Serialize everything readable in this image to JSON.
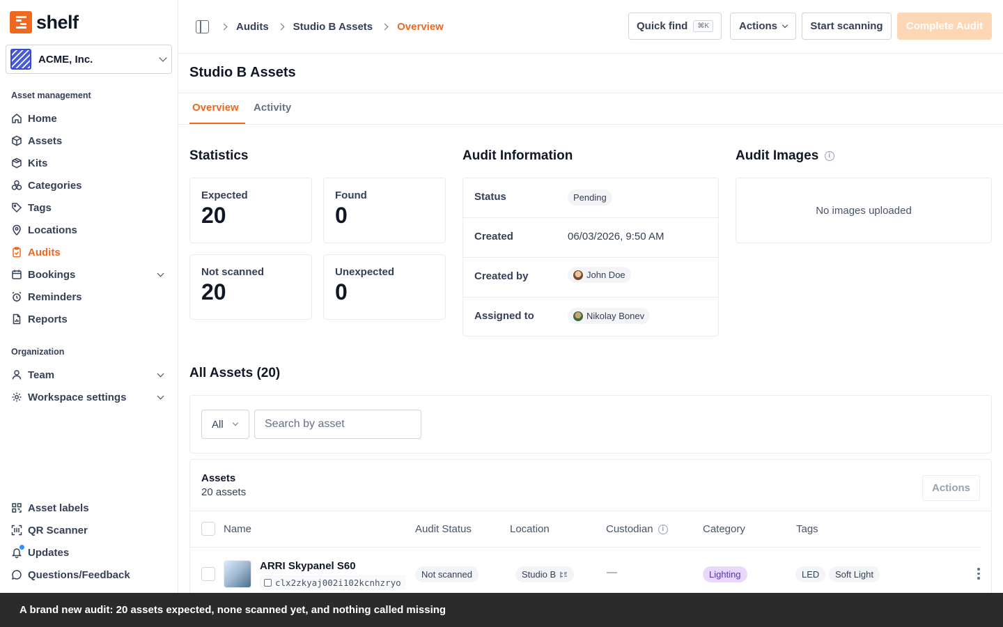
{
  "brand": {
    "name": "shelf"
  },
  "org": {
    "name": "ACME, Inc."
  },
  "sidebar": {
    "section_asset_mgmt": "Asset management",
    "section_org": "Organization",
    "items": [
      {
        "label": "Home",
        "icon": "home-icon"
      },
      {
        "label": "Assets",
        "icon": "box-icon"
      },
      {
        "label": "Kits",
        "icon": "package-icon"
      },
      {
        "label": "Categories",
        "icon": "shapes-icon"
      },
      {
        "label": "Tags",
        "icon": "tag-icon"
      },
      {
        "label": "Locations",
        "icon": "map-pin-icon"
      },
      {
        "label": "Audits",
        "icon": "clipboard-icon",
        "active": true
      },
      {
        "label": "Bookings",
        "icon": "calendar-icon"
      },
      {
        "label": "Reminders",
        "icon": "alarm-icon"
      },
      {
        "label": "Reports",
        "icon": "file-chart-icon"
      }
    ],
    "org_items": [
      {
        "label": "Team",
        "icon": "user-icon"
      },
      {
        "label": "Workspace settings",
        "icon": "gear-icon"
      }
    ],
    "bottom_items": [
      {
        "label": "Asset labels",
        "icon": "qr-code-icon"
      },
      {
        "label": "QR Scanner",
        "icon": "scan-icon"
      },
      {
        "label": "Updates",
        "icon": "bell-icon"
      },
      {
        "label": "Questions/Feedback",
        "icon": "message-icon"
      }
    ]
  },
  "header": {
    "breadcrumbs": [
      "Audits",
      "Studio B Assets",
      "Overview"
    ],
    "quick_find": "Quick find",
    "quick_find_kbd": "⌘K",
    "actions": "Actions",
    "start_scanning": "Start scanning",
    "complete_audit": "Complete Audit"
  },
  "page": {
    "title": "Studio B Assets",
    "tabs": [
      "Overview",
      "Activity"
    ]
  },
  "statistics": {
    "heading": "Statistics",
    "expected_label": "Expected",
    "expected_value": "20",
    "found_label": "Found",
    "found_value": "0",
    "not_scanned_label": "Not scanned",
    "not_scanned_value": "20",
    "unexpected_label": "Unexpected",
    "unexpected_value": "0"
  },
  "audit_info": {
    "heading": "Audit Information",
    "status_label": "Status",
    "status_value": "Pending",
    "created_label": "Created",
    "created_value": "06/03/2026, 9:50 AM",
    "created_by_label": "Created by",
    "created_by_value": "John Doe",
    "assigned_label": "Assigned to",
    "assigned_value": "Nikolay Bonev"
  },
  "audit_images": {
    "heading": "Audit Images",
    "empty": "No images uploaded"
  },
  "assets": {
    "heading": "All Assets (20)",
    "filter_value": "All",
    "search_placeholder": "Search by asset",
    "table_title": "Assets",
    "table_subtitle": "20 assets",
    "actions": "Actions",
    "columns": [
      "Name",
      "Audit Status",
      "Location",
      "Custodian",
      "Category",
      "Tags"
    ],
    "rows": [
      {
        "name": "ARRI Skypanel S60",
        "id": "clx2zkyaj002i102kcnhzryo",
        "status": "Not scanned",
        "location": "Studio B",
        "custodian": "—",
        "category": "Lighting",
        "tags": [
          "LED",
          "Soft Light"
        ]
      }
    ]
  },
  "toast": "A brand new audit: 20 assets expected, none scanned yet, and nothing called missing"
}
